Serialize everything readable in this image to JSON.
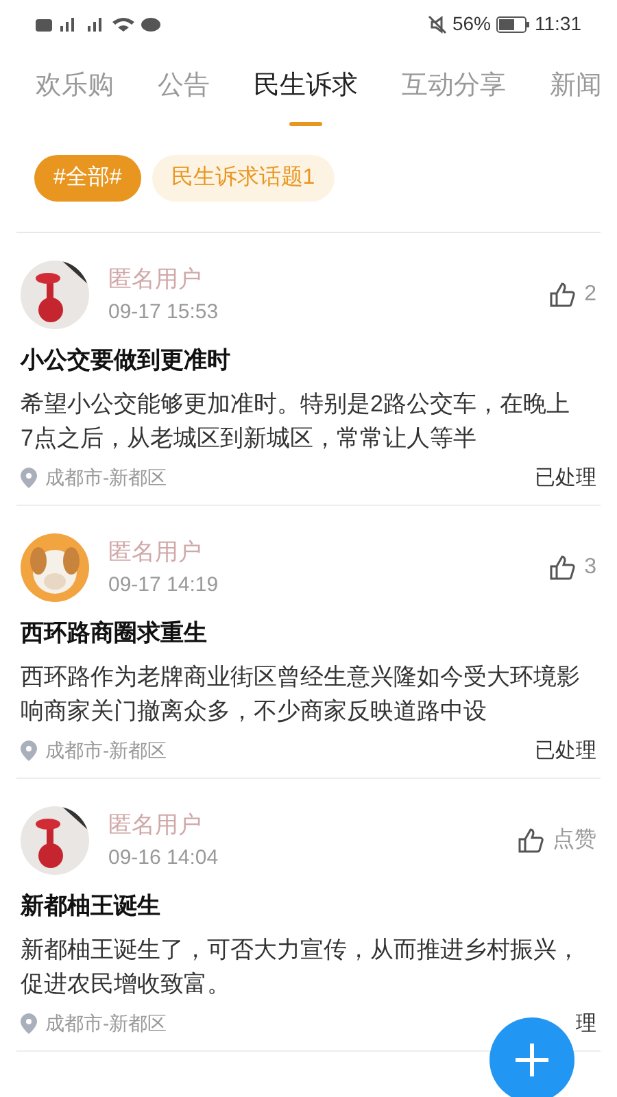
{
  "status_bar": {
    "battery_text": "56%",
    "time": "11:31"
  },
  "tabs": [
    {
      "label": "欢乐购",
      "selected": false
    },
    {
      "label": "公告",
      "selected": false
    },
    {
      "label": "民生诉求",
      "selected": true
    },
    {
      "label": "互动分享",
      "selected": false
    },
    {
      "label": "新闻",
      "selected": false
    }
  ],
  "topics": [
    {
      "label": "#全部#",
      "selected": true
    },
    {
      "label": "民生诉求话题1",
      "selected": false
    }
  ],
  "posts": [
    {
      "user": "匿名用户",
      "time": "09-17 15:53",
      "likes": "2",
      "title": "小公交要做到更准时",
      "body": "希望小公交能够更加准时。特别是2路公交车，在晚上7点之后，从老城区到新城区，常常让人等半",
      "location": "成都市-新都区",
      "status": "已处理"
    },
    {
      "user": "匿名用户",
      "time": "09-17 14:19",
      "likes": "3",
      "title": "西环路商圈求重生",
      "body": "西环路作为老牌商业街区曾经生意兴隆如今受大环境影响商家关门撤离众多，不少商家反映道路中设",
      "location": "成都市-新都区",
      "status": "已处理"
    },
    {
      "user": "匿名用户",
      "time": "09-16 14:04",
      "likes": "点赞",
      "title": "新都柚王诞生",
      "body": "新都柚王诞生了，可否大力宣传，从而推进乡村振兴，促进农民增收致富。",
      "location": "成都市-新都区",
      "status": "理"
    }
  ]
}
